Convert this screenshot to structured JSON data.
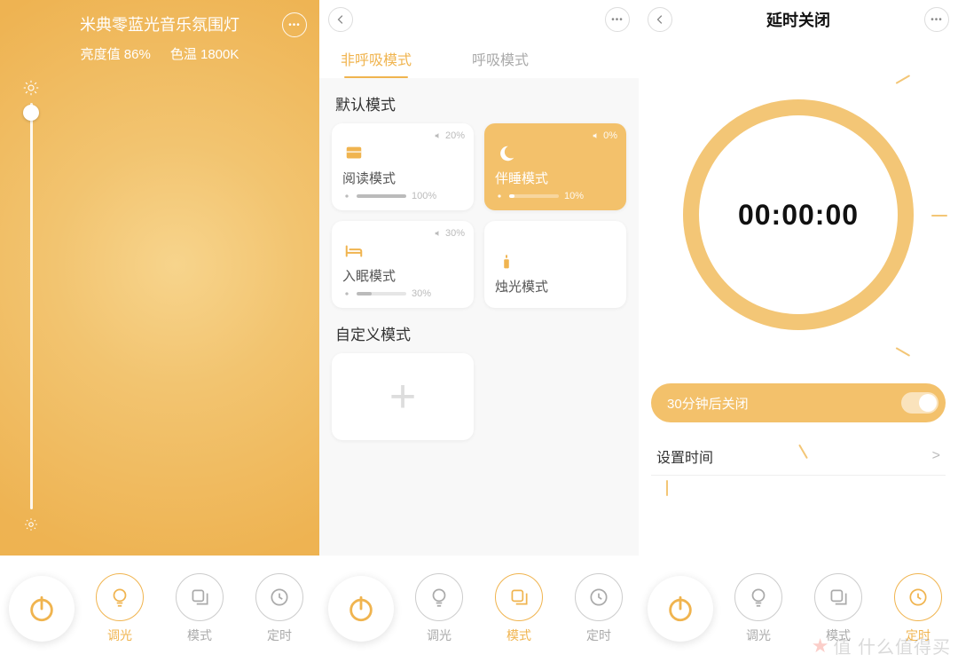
{
  "colors": {
    "accent": "#f0b44f",
    "accent_soft": "#f3c16b"
  },
  "nav_labels": {
    "dim": "调光",
    "mode": "模式",
    "timer": "定时"
  },
  "screen1": {
    "title": "米典零蓝光音乐氛围灯",
    "brightness_label": "亮度值 86%",
    "temp_label": "色温 1800K",
    "active_tab": "dim"
  },
  "screen2": {
    "tabs": [
      "非呼吸模式",
      "呼吸模式"
    ],
    "active_tab_index": 0,
    "section_default": "默认模式",
    "section_custom": "自定义模式",
    "modes": [
      {
        "icon": "book",
        "name": "阅读模式",
        "top_pct": "20%",
        "brightness": "100%",
        "fill": 100,
        "selected": false
      },
      {
        "icon": "moon",
        "name": "伴睡模式",
        "top_pct": "0%",
        "brightness": "10%",
        "fill": 10,
        "selected": true
      },
      {
        "icon": "bed",
        "name": "入眠模式",
        "top_pct": "30%",
        "brightness": "30%",
        "fill": 30,
        "selected": false
      },
      {
        "icon": "candle",
        "name": "烛光模式",
        "top_pct": "",
        "brightness": "",
        "fill": 0,
        "selected": false
      }
    ],
    "active_nav": "mode"
  },
  "screen3": {
    "title": "延时关闭",
    "time": "00:00:00",
    "option_label": "30分钟后关闭",
    "option_on": true,
    "setting_label": "设置时间",
    "active_nav": "timer"
  },
  "watermark": "值   什么值得买"
}
